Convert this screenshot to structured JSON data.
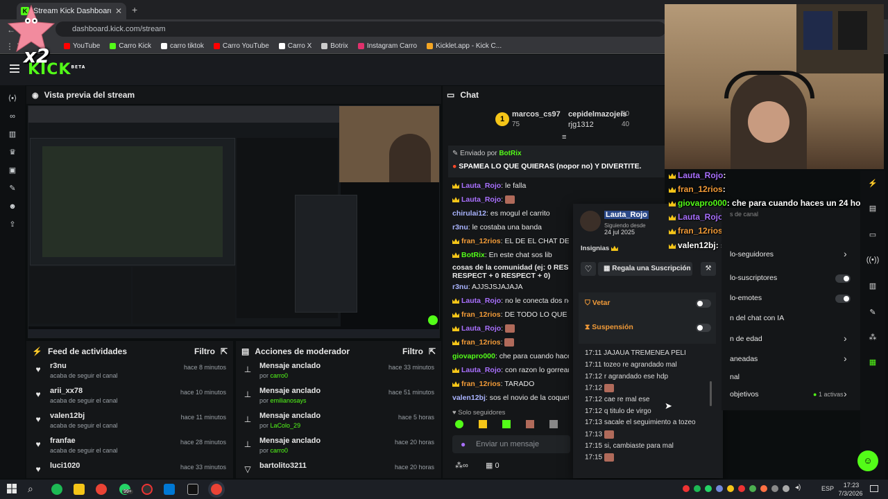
{
  "browser": {
    "tab_title": "Stream Kick Dashboard",
    "address": "dashboard.kick.com/stream",
    "bookmarks": [
      {
        "label": "YouTube",
        "color": "#ff0000"
      },
      {
        "label": "Carro Kick",
        "color": "#53fc18"
      },
      {
        "label": "carro tiktok",
        "color": "#ffffff"
      },
      {
        "label": "Carro YouTube",
        "color": "#ff0000"
      },
      {
        "label": "Carro X",
        "color": "#ffffff"
      },
      {
        "label": "Botrix",
        "color": "#cccccc"
      },
      {
        "label": "Instagram Carro",
        "color": "#e1306c"
      },
      {
        "label": "Kicklet.app - Kick C...",
        "color": "#f5a623"
      }
    ]
  },
  "overlay": {
    "x2": "x2",
    "logo": "KICK",
    "beta": "BETA"
  },
  "preview": {
    "title": "Vista previa del stream"
  },
  "activity": {
    "title": "Feed de actividades",
    "filter": "Filtro",
    "items": [
      {
        "name": "r3nu",
        "sub": "acaba de seguir el canal",
        "time": "hace 8 minutos"
      },
      {
        "name": "arii_xx78",
        "sub": "acaba de seguir el canal",
        "time": "hace 10 minutos"
      },
      {
        "name": "valen12bj",
        "sub": "acaba de seguir el canal",
        "time": "hace 11 minutos"
      },
      {
        "name": "franfae",
        "sub": "acaba de seguir el canal",
        "time": "hace 28 minutos"
      },
      {
        "name": "luci1020",
        "sub": "",
        "time": "hace 33 minutos"
      }
    ]
  },
  "modactions": {
    "title": "Acciones de moderador",
    "filter": "Filtro",
    "items": [
      {
        "name": "Mensaje anclado",
        "by": "por",
        "user": "carro0",
        "time": "hace 33 minutos"
      },
      {
        "name": "Mensaje anclado",
        "by": "por",
        "user": "emilianosays",
        "time": "hace 51 minutos"
      },
      {
        "name": "Mensaje anclado",
        "by": "por",
        "user": "LaColo_29",
        "time": "hace 5 horas"
      },
      {
        "name": "Mensaje anclado",
        "by": "por",
        "user": "carro0",
        "time": "hace 20 horas"
      },
      {
        "name": "bartolito3211",
        "by": "",
        "user": "",
        "time": "hace 20 horas"
      }
    ]
  },
  "chat": {
    "title": "Chat",
    "leaders": [
      {
        "name": "marcos_cs97",
        "value": "75"
      },
      {
        "name": "cepidelmazojeis",
        "value": "50"
      },
      {
        "name": "rjg1312",
        "value": "40"
      }
    ],
    "pinned_label": "Enviado por",
    "pinned_user": "BotRix",
    "pinned_text": "SPAMEA LO QUE QUIERAS (nopor no) Y DIVERTITE.",
    "messages": [
      {
        "user": "Lauta_Rojo",
        "cls": "u",
        "text": ": le falla"
      },
      {
        "user": "Lauta_Rojo",
        "cls": "u",
        "text": ":"
      },
      {
        "user": "chirulai12",
        "cls": "b",
        "text": ": es mogul el carrito"
      },
      {
        "user": "r3nu",
        "cls": "b",
        "text": ": le costaba una banda"
      },
      {
        "user": "fran_12rios",
        "cls": "o",
        "text": ": EL DE EL CHAT DE LO Q"
      },
      {
        "user": "BotRix",
        "cls": "g",
        "text": ": En este chat sos lib"
      },
      {
        "user": "",
        "cls": "",
        "text": "cosas de la comunidad (ej: 0 RESPEC"
      },
      {
        "user": "",
        "cls": "",
        "text": "RESPECT + 0 RESPECT + 0)"
      },
      {
        "user": "r3nu",
        "cls": "b",
        "text": ": AJJSJSJAJAJA"
      },
      {
        "user": "Lauta_Rojo",
        "cls": "u",
        "text": ": no le conecta dos neuro"
      },
      {
        "user": "fran_12rios",
        "cls": "o",
        "text": ": DE TODO LO QUE ESCR"
      },
      {
        "user": "Lauta_Rojo",
        "cls": "u",
        "text": ":"
      },
      {
        "user": "fran_12rios",
        "cls": "o",
        "text": ":"
      },
      {
        "user": "giovapro000",
        "cls": "g",
        "text": ": che para cuando haces u"
      },
      {
        "user": "Lauta_Rojo",
        "cls": "u",
        "text": ": con razon lo gorrean"
      },
      {
        "user": "fran_12rios",
        "cls": "o",
        "text": ": TARADO"
      },
      {
        "user": "valen12bj",
        "cls": "b",
        "text": ": sos el novio de la coqueta?"
      }
    ],
    "followers_only": "Solo seguidores",
    "input_placeholder": "Enviar un mensaje",
    "bottom_count": "0"
  },
  "usercard": {
    "name": "Lauta_Rojo",
    "following_label": "Siguiendo desde",
    "following_date": "24 jul 2025",
    "badges_label": "Insignias",
    "gift_label": "Regala una Suscripción",
    "veto_label": "Vetar",
    "suspension_label": "Suspensión",
    "history": [
      {
        "time": "17:11",
        "text": "JAJAUA TREMENEA PELI"
      },
      {
        "time": "17:11",
        "text": "tozeo re agrandado mal"
      },
      {
        "time": "17:12",
        "text": "r agrandado ese hdp"
      },
      {
        "time": "17:12",
        "text": ""
      },
      {
        "time": "17:12",
        "text": "cae re mal ese"
      },
      {
        "time": "17:12",
        "text": "q titulo de virgo"
      },
      {
        "time": "17:13",
        "text": "sacale el seguimiento a tozeo"
      },
      {
        "time": "17:13",
        "text": ""
      },
      {
        "time": "17:15",
        "text": "si, cambiaste para mal"
      },
      {
        "time": "17:15",
        "text": ""
      }
    ]
  },
  "overlay_chat": [
    {
      "user": "Lauta_Rojo",
      "text": ":",
      "color": "#a970ff"
    },
    {
      "user": "fran_12rios",
      "text": ":",
      "color": "#f29b38"
    },
    {
      "user": "giovapro000",
      "text": ": che para cuando haces un 24 horas",
      "color": "#53fc18"
    },
    {
      "user": "Lauta_Rojo",
      "text": ": con razon lo gorrean",
      "color": "#a970ff"
    },
    {
      "user": "fran_12rios",
      "text": ": TARADO",
      "color": "#f29b38"
    },
    {
      "user": "valen12bj",
      "text": ": sos el novio de la coqueta?",
      "color": "#ffffff"
    }
  ],
  "settings": {
    "items": [
      {
        "label": "lo-seguidores"
      },
      {
        "label": "lo-suscriptores"
      },
      {
        "label": "lo-emotes"
      },
      {
        "label": "n del chat con IA"
      },
      {
        "label": "n de edad"
      },
      {
        "label": "aneadas"
      },
      {
        "label": "nal"
      },
      {
        "label": "objetivos"
      }
    ],
    "active_label": "1 activas",
    "top_label": "s de canal"
  },
  "taskbar": {
    "lang": "ESP",
    "time": "17:23",
    "date": "7/3/2026",
    "badge": "99+"
  }
}
